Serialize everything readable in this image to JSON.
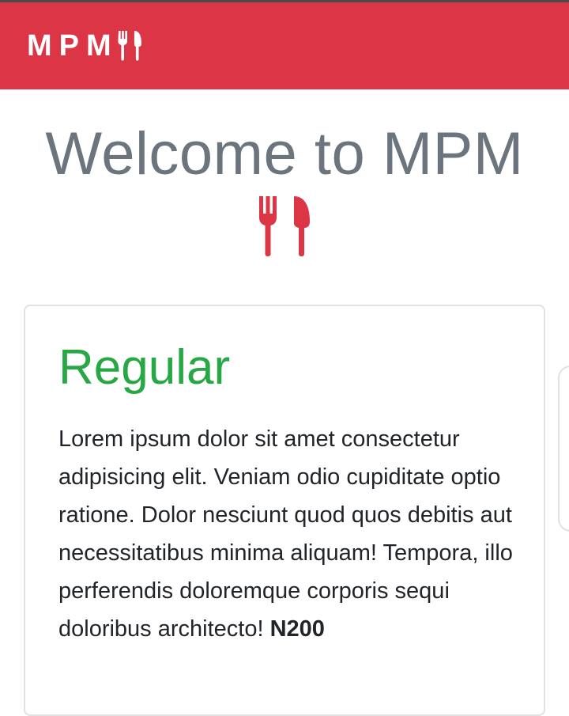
{
  "navbar": {
    "brand": "MPM",
    "brand_icon": "utensils-icon",
    "background": "#dc3545"
  },
  "hero": {
    "title": "Welcome to MPM",
    "icon": "utensils-icon",
    "title_color": "#6c757d",
    "icon_color": "#dc3545"
  },
  "card": {
    "title": "Regular",
    "title_color": "#28a745",
    "text": "Lorem ipsum dolor sit amet consectetur adipisicing elit. Veniam odio cupiditate optio ratione. Dolor nesciunt quod quos debitis aut necessitatibus minima aliquam! Tempora, illo perferendis doloremque corporis sequi doloribus architecto!",
    "price": "N200"
  }
}
